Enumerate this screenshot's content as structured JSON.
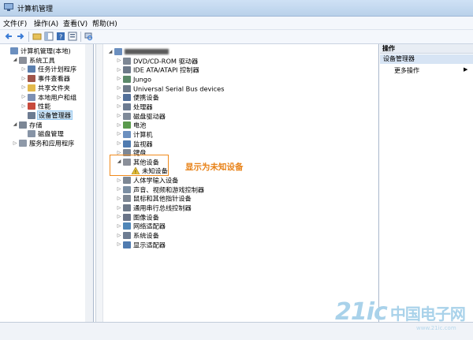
{
  "window": {
    "title": "计算机管理"
  },
  "menu": [
    "文件(F)",
    "操作(A)",
    "查看(V)",
    "帮助(H)"
  ],
  "left_tree": [
    {
      "label": "计算机管理(本地)",
      "indent": 0,
      "toggle": "",
      "icon": "computer-icon",
      "color": "#6b8fbf"
    },
    {
      "label": "系统工具",
      "indent": 1,
      "toggle": "◢",
      "icon": "tools-icon",
      "color": "#8a8f99"
    },
    {
      "label": "任务计划程序",
      "indent": 2,
      "toggle": "▷",
      "icon": "clock-icon",
      "color": "#5b7fae"
    },
    {
      "label": "事件查看器",
      "indent": 2,
      "toggle": "▷",
      "icon": "event-viewer-icon",
      "color": "#a0554a"
    },
    {
      "label": "共享文件夹",
      "indent": 2,
      "toggle": "▷",
      "icon": "folder-icon",
      "color": "#e3b94c"
    },
    {
      "label": "本地用户和组",
      "indent": 2,
      "toggle": "▷",
      "icon": "users-icon",
      "color": "#7c8fb3"
    },
    {
      "label": "性能",
      "indent": 2,
      "toggle": "▷",
      "icon": "performance-icon",
      "color": "#c84a3c"
    },
    {
      "label": "设备管理器",
      "indent": 2,
      "toggle": "",
      "icon": "device-manager-icon",
      "color": "#6d7c92",
      "selected": true
    },
    {
      "label": "存储",
      "indent": 1,
      "toggle": "◢",
      "icon": "storage-icon",
      "color": "#7c8796"
    },
    {
      "label": "磁盘管理",
      "indent": 2,
      "toggle": "",
      "icon": "disk-icon",
      "color": "#8794a6"
    },
    {
      "label": "服务和应用程序",
      "indent": 1,
      "toggle": "▷",
      "icon": "services-icon",
      "color": "#8e99a8"
    }
  ],
  "device_tree": [
    {
      "label": "",
      "indent": 0,
      "toggle": "◢",
      "icon": "computer-icon",
      "color": "#6b8fbf",
      "blurred": true
    },
    {
      "label": "DVD/CD-ROM 驱动器",
      "indent": 1,
      "toggle": "▷",
      "icon": "dvd-drive-icon",
      "color": "#7d8794"
    },
    {
      "label": "IDE ATA/ATAPI 控制器",
      "indent": 1,
      "toggle": "▷",
      "icon": "ide-controller-icon",
      "color": "#6e7a8a"
    },
    {
      "label": "Jungo",
      "indent": 1,
      "toggle": "▷",
      "icon": "device-icon",
      "color": "#5c8a6a"
    },
    {
      "label": "Universal Serial Bus devices",
      "indent": 1,
      "toggle": "▷",
      "icon": "usb-icon",
      "color": "#6e7a8a"
    },
    {
      "label": "便携设备",
      "indent": 1,
      "toggle": "▷",
      "icon": "portable-device-icon",
      "color": "#52709a"
    },
    {
      "label": "处理器",
      "indent": 1,
      "toggle": "▷",
      "icon": "processor-icon",
      "color": "#6d7c92"
    },
    {
      "label": "磁盘驱动器",
      "indent": 1,
      "toggle": "▷",
      "icon": "disk-drive-icon",
      "color": "#7f8a99"
    },
    {
      "label": "电池",
      "indent": 1,
      "toggle": "▷",
      "icon": "battery-icon",
      "color": "#5a9a4c"
    },
    {
      "label": "计算机",
      "indent": 1,
      "toggle": "▷",
      "icon": "computer-icon",
      "color": "#6b8fbf"
    },
    {
      "label": "监视器",
      "indent": 1,
      "toggle": "▷",
      "icon": "monitor-icon",
      "color": "#4f7bb0"
    },
    {
      "label": "键盘",
      "indent": 1,
      "toggle": "▷",
      "icon": "keyboard-icon",
      "color": "#7d8794"
    },
    {
      "label": "其他设备",
      "indent": 1,
      "toggle": "◢",
      "icon": "other-devices-icon",
      "color": "#8a8f99"
    },
    {
      "label": "未知设备",
      "indent": 2,
      "toggle": "",
      "icon": "unknown-device-warning-icon",
      "color": "#e8c23a"
    },
    {
      "label": "人体学输入设备",
      "indent": 1,
      "toggle": "▷",
      "icon": "hid-icon",
      "color": "#7d8794"
    },
    {
      "label": "声音、视频和游戏控制器",
      "indent": 1,
      "toggle": "▷",
      "icon": "sound-icon",
      "color": "#7b8ea3"
    },
    {
      "label": "鼠标和其他指针设备",
      "indent": 1,
      "toggle": "▷",
      "icon": "mouse-icon",
      "color": "#7d8794"
    },
    {
      "label": "通用串行总线控制器",
      "indent": 1,
      "toggle": "▷",
      "icon": "usb-controller-icon",
      "color": "#6e7a8a"
    },
    {
      "label": "图像设备",
      "indent": 1,
      "toggle": "▷",
      "icon": "imaging-device-icon",
      "color": "#6a7488"
    },
    {
      "label": "网络适配器",
      "indent": 1,
      "toggle": "▷",
      "icon": "network-adapter-icon",
      "color": "#4f86b8"
    },
    {
      "label": "系统设备",
      "indent": 1,
      "toggle": "▷",
      "icon": "system-device-icon",
      "color": "#6d7c92"
    },
    {
      "label": "显示适配器",
      "indent": 1,
      "toggle": "▷",
      "icon": "display-adapter-icon",
      "color": "#4f7bb0"
    }
  ],
  "actions": {
    "header": "操作",
    "group": "设备管理器",
    "item": "更多操作"
  },
  "annotation": "显示为未知设备",
  "watermark": {
    "main": "21ic",
    "cn": "中国电子网",
    "url": "www.21ic.com"
  }
}
